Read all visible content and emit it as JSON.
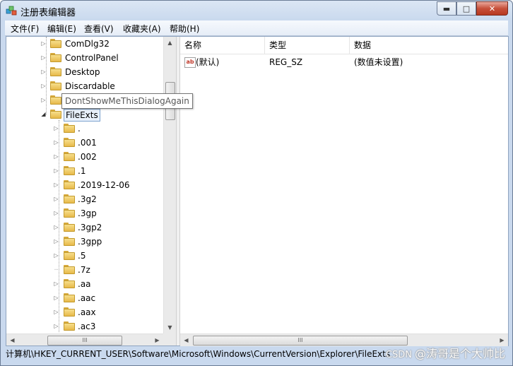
{
  "window": {
    "title": "注册表编辑器",
    "minimize_glyph": "▬",
    "maximize_glyph": "□",
    "close_glyph": "✕"
  },
  "menu": [
    "文件(F)",
    "编辑(E)",
    "查看(V)",
    "收藏夹(A)",
    "帮助(H)"
  ],
  "tree": {
    "upper_items": [
      "ComDlg32",
      "ControlPanel",
      "Desktop",
      "Discardable"
    ],
    "tooltip_item": "DontShowMeThisDialogAgain",
    "expanded_item": "FileExts",
    "children": [
      ".",
      ".001",
      ".002",
      ".1",
      ".2019-12-06",
      ".3g2",
      ".3gp",
      ".3gp2",
      ".3gpp",
      ".5",
      ".7z",
      ".aa",
      ".aac",
      ".aax",
      ".ac3"
    ],
    "leaf_children": [
      ".7z"
    ]
  },
  "list": {
    "columns": [
      "名称",
      "类型",
      "数据"
    ],
    "rows": [
      {
        "name": "(默认)",
        "type": "REG_SZ",
        "data": "(数值未设置)",
        "icon": "string-value-icon"
      }
    ]
  },
  "scrollbar": {
    "grip_glyph": "III",
    "up": "▲",
    "down": "▼",
    "left": "◀",
    "right": "▶"
  },
  "statusbar": {
    "path": "计算机\\HKEY_CURRENT_USER\\Software\\Microsoft\\Windows\\CurrentVersion\\Explorer\\FileExts"
  },
  "watermark": {
    "prefix": "CSDN",
    "text": "@涛哥是个大帅比"
  }
}
